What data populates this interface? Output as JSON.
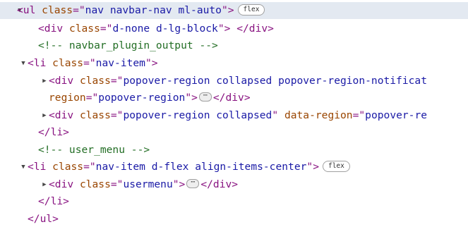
{
  "elements_panel": {
    "nodes": [
      {
        "toggle": "▼",
        "parts": [
          {
            "c": "tag",
            "t": "<ul"
          },
          {
            "t": " "
          },
          {
            "c": "an",
            "t": "class"
          },
          {
            "c": "tag",
            "t": "=\""
          },
          {
            "c": "av",
            "t": "nav navbar-nav ml-auto"
          },
          {
            "c": "tag",
            "t": "\">"
          }
        ],
        "badge": "flex"
      },
      {
        "parts": [
          {
            "c": "tag",
            "t": "<div"
          },
          {
            "t": " "
          },
          {
            "c": "an",
            "t": "class"
          },
          {
            "c": "tag",
            "t": "=\""
          },
          {
            "c": "av",
            "t": "d-none d-lg-block"
          },
          {
            "c": "tag",
            "t": "\">"
          },
          {
            "t": " "
          },
          {
            "c": "tag",
            "t": "</div>"
          }
        ]
      },
      {
        "parts": [
          {
            "c": "cm",
            "t": "<!-- navbar_plugin_output -->"
          }
        ]
      },
      {
        "toggle": "▼",
        "parts": [
          {
            "c": "tag",
            "t": "<li"
          },
          {
            "t": " "
          },
          {
            "c": "an",
            "t": "class"
          },
          {
            "c": "tag",
            "t": "=\""
          },
          {
            "c": "av",
            "t": "nav-item"
          },
          {
            "c": "tag",
            "t": "\">"
          }
        ]
      },
      {
        "toggle": "▶",
        "parts": [
          {
            "c": "tag",
            "t": "<div"
          },
          {
            "t": " "
          },
          {
            "c": "an",
            "t": "class"
          },
          {
            "c": "tag",
            "t": "=\""
          },
          {
            "c": "av",
            "t": "popover-region collapsed popover-region-notificat"
          }
        ]
      },
      {
        "parts": [
          {
            "c": "an",
            "t": "region"
          },
          {
            "c": "tag",
            "t": "=\""
          },
          {
            "c": "av",
            "t": "popover-region"
          },
          {
            "c": "tag",
            "t": "\">"
          },
          {
            "ellipsis": "⋯"
          },
          {
            "c": "tag",
            "t": "</div>"
          }
        ]
      },
      {
        "toggle": "▶",
        "parts": [
          {
            "c": "tag",
            "t": "<div"
          },
          {
            "t": " "
          },
          {
            "c": "an",
            "t": "class"
          },
          {
            "c": "tag",
            "t": "=\""
          },
          {
            "c": "av",
            "t": "popover-region collapsed"
          },
          {
            "c": "tag",
            "t": "\""
          },
          {
            "t": " "
          },
          {
            "c": "an",
            "t": "data-region"
          },
          {
            "c": "tag",
            "t": "=\""
          },
          {
            "c": "av",
            "t": "popover-re"
          }
        ]
      },
      {
        "parts": [
          {
            "c": "tag",
            "t": "</li>"
          }
        ]
      },
      {
        "parts": [
          {
            "c": "cm",
            "t": "<!-- user_menu -->"
          }
        ]
      },
      {
        "toggle": "▼",
        "parts": [
          {
            "c": "tag",
            "t": "<li"
          },
          {
            "t": " "
          },
          {
            "c": "an",
            "t": "class"
          },
          {
            "c": "tag",
            "t": "=\""
          },
          {
            "c": "av",
            "t": "nav-item d-flex align-items-center"
          },
          {
            "c": "tag",
            "t": "\">"
          }
        ],
        "badge": "flex"
      },
      {
        "toggle": "▶",
        "parts": [
          {
            "c": "tag",
            "t": "<div"
          },
          {
            "t": " "
          },
          {
            "c": "an",
            "t": "class"
          },
          {
            "c": "tag",
            "t": "=\""
          },
          {
            "c": "av",
            "t": "usermenu"
          },
          {
            "c": "tag",
            "t": "\">"
          },
          {
            "ellipsis": "⋯"
          },
          {
            "c": "tag",
            "t": "</div>"
          }
        ]
      },
      {
        "parts": [
          {
            "c": "tag",
            "t": "</li>"
          }
        ]
      },
      {
        "parts": [
          {
            "c": "tag",
            "t": "</ul>"
          }
        ]
      }
    ]
  }
}
